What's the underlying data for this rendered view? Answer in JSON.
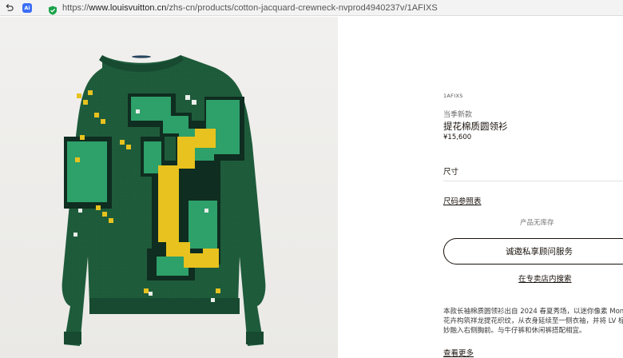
{
  "browser": {
    "url_protocol": "https://",
    "url_host": "www.louisvuitton.cn",
    "url_path": "/zhs-cn/products/cotton-jacquard-crewneck-nvprod4940237v/1AFIXS",
    "ai_badge": "Ai"
  },
  "product": {
    "image_alt": "提花棉质圆领衫",
    "sku": "1AFIXS",
    "season_tag": "当季新款",
    "name": "提花棉质圆领衫",
    "price": "¥15,600",
    "size_label": "尺寸",
    "size_chart_link": "尺码参照表",
    "stock_status": "产品无库存",
    "advisor_button": "诚邀私享顾问服务",
    "store_link": "在专卖店内搜索",
    "description": "本款长袖棉质圆领衫出自 2024 春夏秀场，以迷你像素 Mon 花卉构筑祥龙提花织纹，从衣身延续至一侧衣袖，并将 LV 标 妙融入右侧胸前。与牛仔裤和休闲裤搭配相宜。",
    "see_more": "查看更多"
  },
  "colors": {
    "sweater_green": "#1d5a3a",
    "pattern_yellow": "#e8c21e",
    "pattern_teal": "#2ea06a",
    "pattern_dark": "#0f2d20"
  }
}
